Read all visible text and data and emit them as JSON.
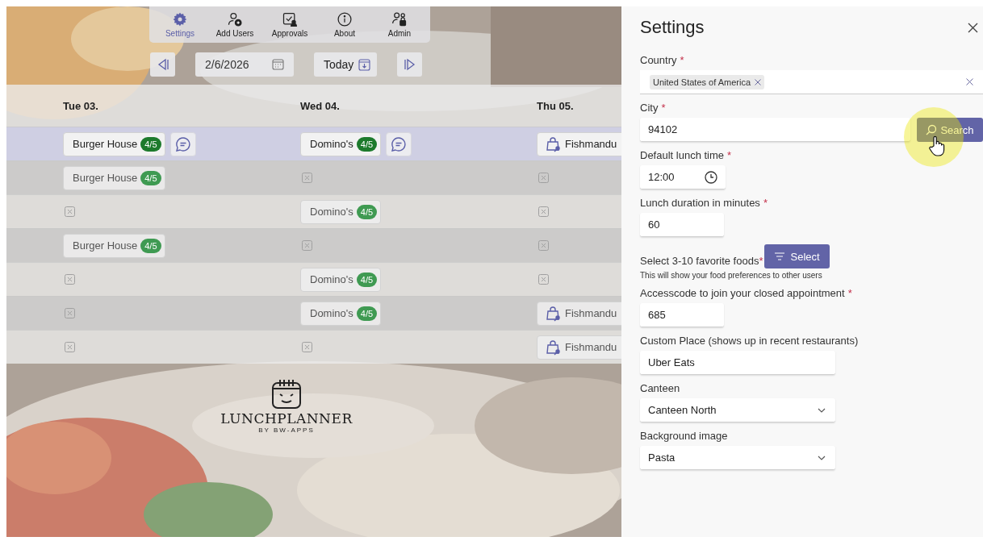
{
  "toolbar": [
    {
      "label": "Settings",
      "selected": true
    },
    {
      "label": "Add Users",
      "selected": false
    },
    {
      "label": "Approvals",
      "selected": false
    },
    {
      "label": "About",
      "selected": false
    },
    {
      "label": "Admin",
      "selected": false
    }
  ],
  "date_nav": {
    "date": "2/6/2026",
    "today": "Today"
  },
  "schedule": {
    "columns": [
      "Tue 03.",
      "Wed 04.",
      "Thu 05."
    ],
    "rows": [
      {
        "selected": true,
        "cells": [
          {
            "kind": "entry",
            "name": "Burger House",
            "badge": "4/5",
            "chat": true
          },
          {
            "kind": "entry",
            "name": "Domino's",
            "badge": "4/5",
            "chat": true
          },
          {
            "kind": "takeout",
            "name": "Fishmandu"
          }
        ]
      },
      {
        "selected": false,
        "cells": [
          {
            "kind": "entry",
            "name": "Burger House",
            "badge": "4/5",
            "chat": false
          },
          {
            "kind": "empty"
          },
          {
            "kind": "empty"
          }
        ]
      },
      {
        "selected": false,
        "cells": [
          {
            "kind": "empty"
          },
          {
            "kind": "entry",
            "name": "Domino's",
            "badge": "4/5",
            "chat": false
          },
          {
            "kind": "empty"
          }
        ]
      },
      {
        "selected": false,
        "cells": [
          {
            "kind": "entry",
            "name": "Burger House",
            "badge": "4/5",
            "chat": false
          },
          {
            "kind": "empty"
          },
          {
            "kind": "empty"
          }
        ]
      },
      {
        "selected": false,
        "cells": [
          {
            "kind": "empty"
          },
          {
            "kind": "entry",
            "name": "Domino's",
            "badge": "4/5",
            "chat": false
          },
          {
            "kind": "empty"
          }
        ]
      },
      {
        "selected": false,
        "cells": [
          {
            "kind": "empty"
          },
          {
            "kind": "entry",
            "name": "Domino's",
            "badge": "4/5",
            "chat": false
          },
          {
            "kind": "takeout",
            "name": "Fishmandu"
          }
        ]
      },
      {
        "selected": false,
        "cells": [
          {
            "kind": "empty"
          },
          {
            "kind": "empty"
          },
          {
            "kind": "takeout",
            "name": "Fishmandu"
          }
        ]
      }
    ]
  },
  "logo": {
    "name": "LUNCHPLANNER",
    "tagline": "BY BW-APPS"
  },
  "settings": {
    "title": "Settings",
    "fields": [
      {
        "kind": "tags",
        "label": "Country",
        "required_mark": "*",
        "tags": [
          "United States of America"
        ]
      },
      {
        "kind": "search",
        "label": "City",
        "required_mark": "*",
        "value": "94102",
        "button": "Search"
      },
      {
        "kind": "time",
        "label": "Default lunch time",
        "required_mark": "*",
        "value": "12:00"
      },
      {
        "kind": "number",
        "label": "Lunch duration in minutes",
        "required_mark": "*",
        "value": "60"
      },
      {
        "kind": "picker",
        "label": "Select 3-10 favorite foods",
        "required_mark": "*",
        "button": "Select",
        "hint": "This will show your food preferences to other users"
      },
      {
        "kind": "number",
        "label": "Accesscode to join your closed appointment",
        "required_mark": "*",
        "value": "685"
      },
      {
        "kind": "text",
        "label": "Custom Place (shows up in recent restaurants)",
        "value": "Uber Eats"
      },
      {
        "kind": "select",
        "label": "Canteen",
        "value": "Canteen North"
      },
      {
        "kind": "select",
        "label": "Background image",
        "value": "Pasta"
      }
    ]
  }
}
